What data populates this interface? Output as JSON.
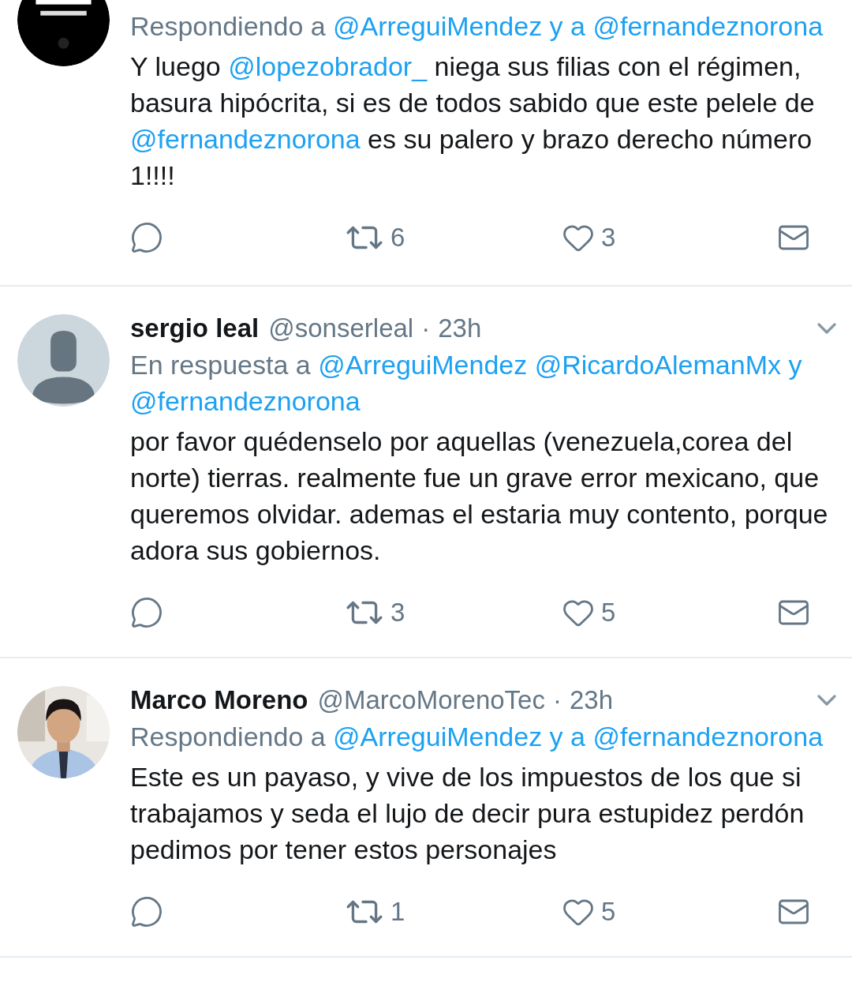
{
  "tweets": [
    {
      "avatar": {
        "kind": "picture"
      },
      "reply_to": [
        {
          "text": "Respondiendo a ",
          "link": false
        },
        {
          "text": "@ArreguiMendez y a",
          "link": true
        },
        {
          "text": "@fernandeznorona",
          "link": true
        }
      ],
      "body": [
        {
          "text": "Y luego ",
          "link": false
        },
        {
          "text": "@lopezobrador_",
          "link": true
        },
        {
          "text": " niega sus filias con el régimen, basura hipócrita, si es de todos sabido que este pelele de ",
          "link": false
        },
        {
          "text": "@fernandeznorona",
          "link": true
        },
        {
          "text": " es su palero y brazo derecho número 1!!!!",
          "link": false
        }
      ],
      "actions": [
        {
          "kind": "reply"
        },
        {
          "kind": "retweet",
          "count": "6"
        },
        {
          "kind": "like",
          "count": "3"
        },
        {
          "kind": "message"
        }
      ]
    },
    {
      "avatar": {
        "kind": "default"
      },
      "name": "sergio leal",
      "handle": "@sonserleal",
      "separator": "·",
      "time": "23h",
      "reply_to": [
        {
          "text": "En respuesta a ",
          "link": false
        },
        {
          "text": "@ArreguiMendez",
          "link": true
        },
        {
          "text": "@RicardoAlemanMx y",
          "link": true
        },
        {
          "text": "@fernandeznorona",
          "link": true
        }
      ],
      "body": [
        {
          "text": "por favor quédenselo por aquellas (venezuela,corea del norte) tierras. realmente fue un grave error mexicano, que queremos olvidar. ademas el estaria muy contento, porque adora sus gobiernos.",
          "link": false
        }
      ],
      "actions": [
        {
          "kind": "reply"
        },
        {
          "kind": "retweet",
          "count": "3"
        },
        {
          "kind": "like",
          "count": "5"
        },
        {
          "kind": "message"
        }
      ]
    },
    {
      "avatar": {
        "kind": "picture"
      },
      "name": "Marco Moreno",
      "handle": "@MarcoMorenoTec",
      "separator": "·",
      "time": "23h",
      "reply_to": [
        {
          "text": "Respondiendo a ",
          "link": false
        },
        {
          "text": "@ArreguiMendez y a",
          "link": true
        },
        {
          "text": "@fernandeznorona",
          "link": true
        }
      ],
      "body": [
        {
          "text": "Este es un payaso, y vive de los impuestos de los que si trabajamos y seda el lujo de decir pura estupidez perdón pedimos por tener estos personajes",
          "link": false
        }
      ],
      "actions": [
        {
          "kind": "reply"
        },
        {
          "kind": "retweet",
          "count": "1"
        },
        {
          "kind": "like",
          "count": "5"
        },
        {
          "kind": "message"
        }
      ]
    }
  ]
}
